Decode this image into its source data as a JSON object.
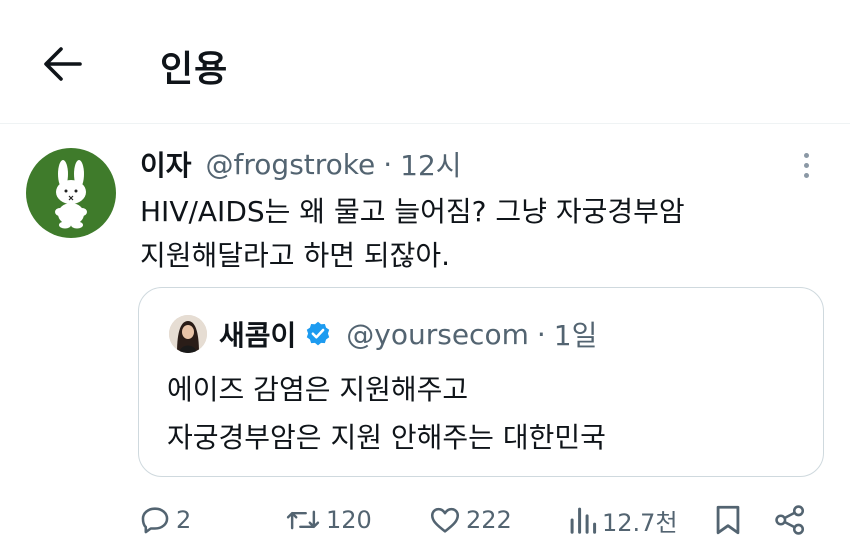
{
  "header": {
    "title": "인용",
    "back_icon": "arrow-left-icon"
  },
  "post": {
    "author_name": "이자",
    "author_handle": "@frogstroke",
    "separator": "·",
    "time": "12시",
    "text_lines": [
      "HIV/AIDS는 왜 물고 늘어짐? 그냥 자궁경부암",
      "지원해달라고 하면 되잖아."
    ],
    "avatar_bg": "#3f7b2b"
  },
  "quote": {
    "author_name": "새콤이",
    "verified": true,
    "verified_color": "#1d9bf0",
    "author_handle": "@yoursecom",
    "separator": "·",
    "time": "1일",
    "text_lines": [
      "에이즈 감염은 지원해주고",
      "자궁경부암은 지원 안해주는 대한민국"
    ]
  },
  "actions": {
    "replies": "2",
    "retweets": "120",
    "likes": "222",
    "views": "12.7천",
    "icons": [
      "reply-icon",
      "retweet-icon",
      "like-icon",
      "views-icon",
      "bookmark-icon",
      "share-icon"
    ]
  },
  "colors": {
    "text": "#0f1419",
    "secondary": "#536471",
    "border": "#cfd9de"
  }
}
